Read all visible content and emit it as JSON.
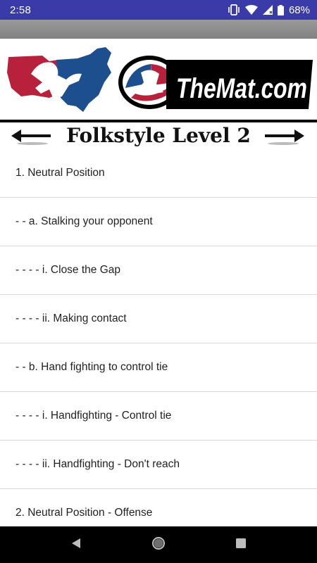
{
  "status_bar": {
    "time": "2:58",
    "battery": "68%",
    "icons": [
      "vibrate-icon",
      "wifi-icon",
      "signal-icon",
      "battery-icon"
    ]
  },
  "banner": {
    "logos": [
      "usa-wrestling-map-logo",
      "themat-logo"
    ],
    "themat_text": "TheMat.com",
    "colors": {
      "red": "#b7213b",
      "blue": "#1d4f8f"
    }
  },
  "header": {
    "title": "Folkstyle Level 2",
    "icons": [
      "arrow-left-icon",
      "arrow-right-icon"
    ]
  },
  "outline": {
    "items": [
      {
        "label": "1. Neutral Position"
      },
      {
        "label": "- - a. Stalking your opponent"
      },
      {
        "label": "- - - - i. Close the Gap"
      },
      {
        "label": "- - - - ii. Making contact"
      },
      {
        "label": "- - b. Hand fighting to control tie"
      },
      {
        "label": "- - - - i. Handfighting - Control tie"
      },
      {
        "label": "- - - - ii. Handfighting - Don't reach"
      },
      {
        "label": "2. Neutral Position - Offense"
      }
    ]
  },
  "nav_bar": {
    "icons": [
      "back-icon",
      "home-icon",
      "recents-icon"
    ]
  }
}
